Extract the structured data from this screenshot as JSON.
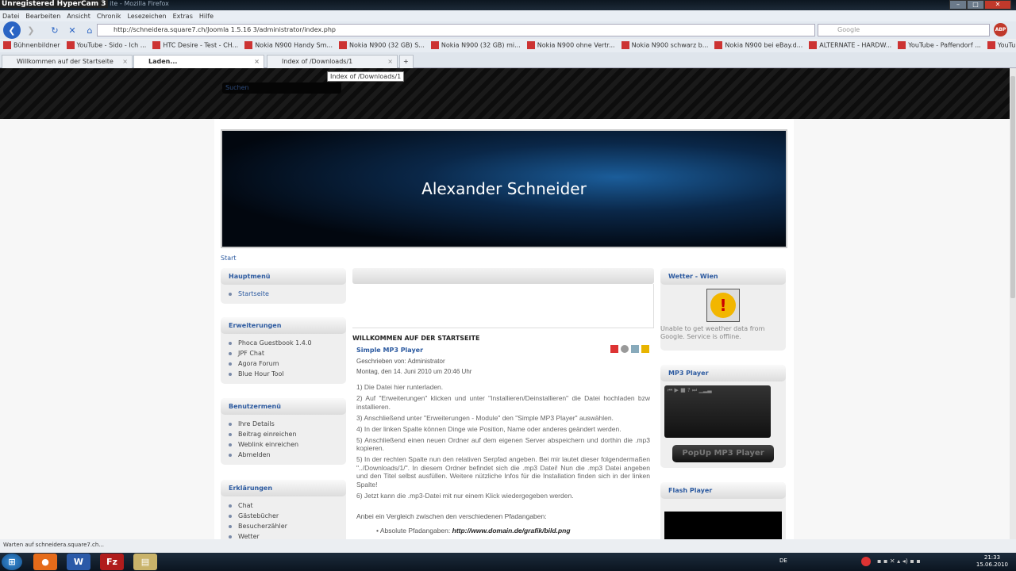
{
  "window": {
    "title_overlay": "Unregistered HyperCam 3",
    "title": "ite - Mozilla Firefox"
  },
  "menu": [
    "Datei",
    "Bearbeiten",
    "Ansicht",
    "Chronik",
    "Lesezeichen",
    "Extras",
    "Hilfe"
  ],
  "nav": {
    "url": "http://schneidera.square7.ch/Joomla 1.5.16 3/administrator/index.php",
    "search_placeholder": "Google",
    "abp": "ABP"
  },
  "bookmarks": [
    "Bühnenbildner",
    "YouTube - Sido - Ich ...",
    "HTC Desire - Test - CH...",
    "Nokia N900 Handy Sm...",
    "Nokia N900 (32 GB) S...",
    "Nokia N900 (32 GB) mi...",
    "Nokia N900 ohne Vertr...",
    "Nokia N900 schwarz b...",
    "Nokia N900 bei eBay.d...",
    "ALTERNATE - HARDW...",
    "YouTube - Paffendorf ...",
    "YouTube - Wavin' Flag..."
  ],
  "tabs": [
    {
      "label": "Willkommen auf der Startseite"
    },
    {
      "label": "Laden..."
    },
    {
      "label": "Index of /Downloads/1"
    }
  ],
  "tooltip": "Index of /Downloads/1",
  "site": {
    "search_label": "Suchen",
    "banner_title": "Alexander Schneider",
    "breadcrumb": "Start"
  },
  "left_modules": [
    {
      "title": "Hauptmenü",
      "items": [
        "Startseite"
      ]
    },
    {
      "title": "Erweiterungen",
      "items": [
        "Phoca Guestbook 1.4.0",
        "JPF Chat",
        "Agora Forum",
        "Blue Hour Tool"
      ]
    },
    {
      "title": "Benutzermenü",
      "items": [
        "Ihre Details",
        "Beitrag einreichen",
        "Weblink einreichen",
        "Abmelden"
      ]
    },
    {
      "title": "Erklärungen",
      "items": [
        "Chat",
        "Gästebücher",
        "Besucherzähler",
        "Wetter"
      ]
    }
  ],
  "article": {
    "section_title": "WILLKOMMEN AUF DER STARTSEITE",
    "title": "Simple MP3 Player",
    "author": "Geschrieben von: Administrator",
    "date": "Montag, den 14. Juni 2010 um 20:46 Uhr",
    "paragraphs": [
      "1) Die Datei hier runterladen.",
      "2) Auf \"Erweiterungen\" klicken und unter \"Installieren/Deinstallieren\" die Datei hochladen bzw installieren.",
      "3) Anschließend unter \"Erweiterungen - Module\" den \"Simple MP3 Player\" auswählen.",
      "4) In der linken Spalte können Dinge wie Position, Name oder anderes geändert werden.",
      "5) Anschließend einen neuen Ordner auf dem eigenen Server abspeichern und dorthin die .mp3 kopieren.",
      "5) In der rechten Spalte nun den relativen Serpfad angeben. Bei mir lautet dieser folgendermaßen \"../Downloads/1/\". In diesem Ordner befindet sich die .mp3 Datei! Nun die .mp3 Datei angeben und den Titel selbst ausfüllen. Weitere nützliche Infos für die Installation finden sich in der linken Spalte!",
      "6) Jetzt kann die .mp3-Datei mit nur einem Klick wiedergegeben werden."
    ],
    "compare_intro": "Anbei ein Vergleich zwischen den verschiedenen Pfadangaben:",
    "list_label": "Absolute Pfadangaben:",
    "list_value": "http://www.domain.de/grafik/bild.png"
  },
  "right": {
    "weather_title": "Wetter - Wien",
    "weather_msg": "Unable to get weather data from Google. Service is offline.",
    "mp3_title": "MP3 Player",
    "popup_label": "PopUp MP3 Player",
    "flash_title": "Flash Player"
  },
  "status": "Warten auf schneidera.square7.ch...",
  "taskbar": {
    "lang": "DE",
    "time": "21:33",
    "date": "15.06.2010"
  }
}
